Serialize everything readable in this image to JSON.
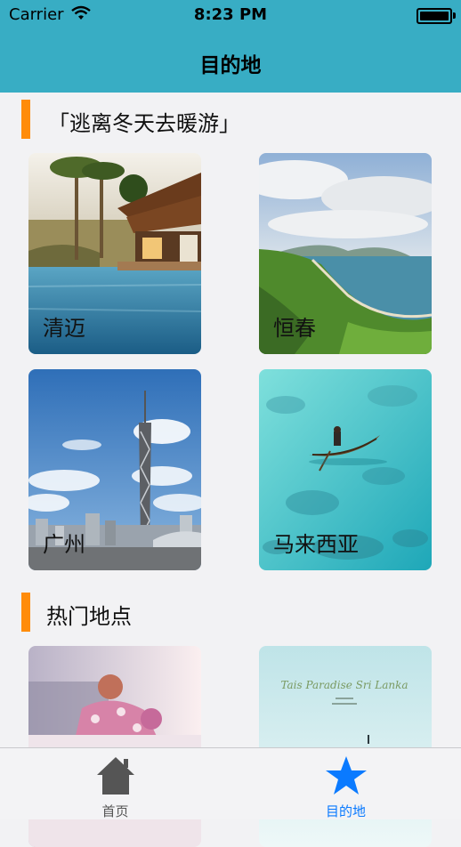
{
  "status": {
    "carrier": "Carrier",
    "time": "8:23 PM"
  },
  "nav": {
    "title": "目的地"
  },
  "sections": [
    {
      "title": "「逃离冬天去暖游」"
    },
    {
      "title": "热门地点"
    }
  ],
  "destinations": [
    {
      "name": "清迈"
    },
    {
      "name": "恒春"
    },
    {
      "name": "广州"
    },
    {
      "name": "马来西亚"
    }
  ],
  "hot_places": [
    {
      "name": ""
    },
    {
      "name": "",
      "caption": "Tais Paradise Sri Lanka"
    }
  ],
  "tabs": [
    {
      "label": "首页",
      "icon": "home-icon",
      "color": "#555555"
    },
    {
      "label": "目的地",
      "icon": "star-icon",
      "color": "#0a7aff"
    }
  ],
  "colors": {
    "brand": "#38adc4",
    "accent": "#ff8c0a",
    "active_tab": "#0a7aff"
  }
}
